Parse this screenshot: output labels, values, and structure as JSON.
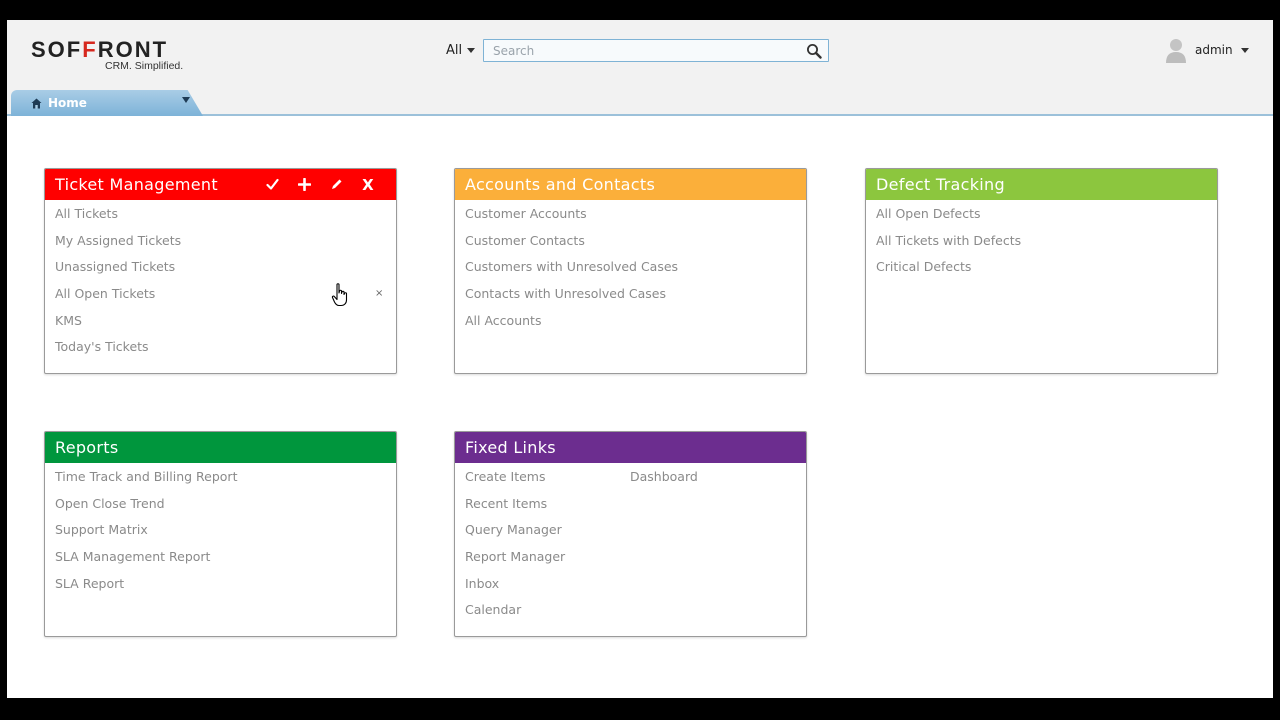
{
  "brand": {
    "logo_part1": "SOF",
    "logo_part2": "F",
    "logo_part3": "RONT",
    "tagline": "CRM. Simplified."
  },
  "search": {
    "scope": "All",
    "placeholder": "Search"
  },
  "user": {
    "name": "admin"
  },
  "tabs": [
    {
      "label": "Home"
    }
  ],
  "colors": {
    "ticket": "#ff0000",
    "accounts": "#fbaf3a",
    "defects": "#8cc63e",
    "reports": "#00963d",
    "fixed": "#6c2d8f"
  },
  "widgets": {
    "ticket": {
      "title": "Ticket Management",
      "actions": [
        "check-icon",
        "plus-icon",
        "edit-icon",
        "X"
      ],
      "links": [
        "All Tickets",
        "My Assigned Tickets",
        "Unassigned Tickets",
        "All Open Tickets",
        "KMS",
        "Today's Tickets"
      ],
      "row_close": "×"
    },
    "accounts": {
      "title": "Accounts and Contacts",
      "links": [
        "Customer Accounts",
        "Customer Contacts",
        "Customers with Unresolved Cases",
        "Contacts with Unresolved Cases",
        "All Accounts"
      ]
    },
    "defects": {
      "title": "Defect Tracking",
      "links": [
        "All Open Defects",
        "All Tickets with Defects",
        "Critical Defects"
      ]
    },
    "reports": {
      "title": "Reports",
      "links": [
        "Time Track and Billing Report",
        "Open Close Trend",
        "Support Matrix",
        "SLA Management Report",
        "SLA Report"
      ]
    },
    "fixed": {
      "title": "Fixed Links",
      "links_col1": [
        "Create Items",
        "Recent Items",
        "Query Manager",
        "Report Manager",
        "Inbox",
        "Calendar"
      ],
      "links_col2": [
        "Dashboard"
      ]
    }
  }
}
